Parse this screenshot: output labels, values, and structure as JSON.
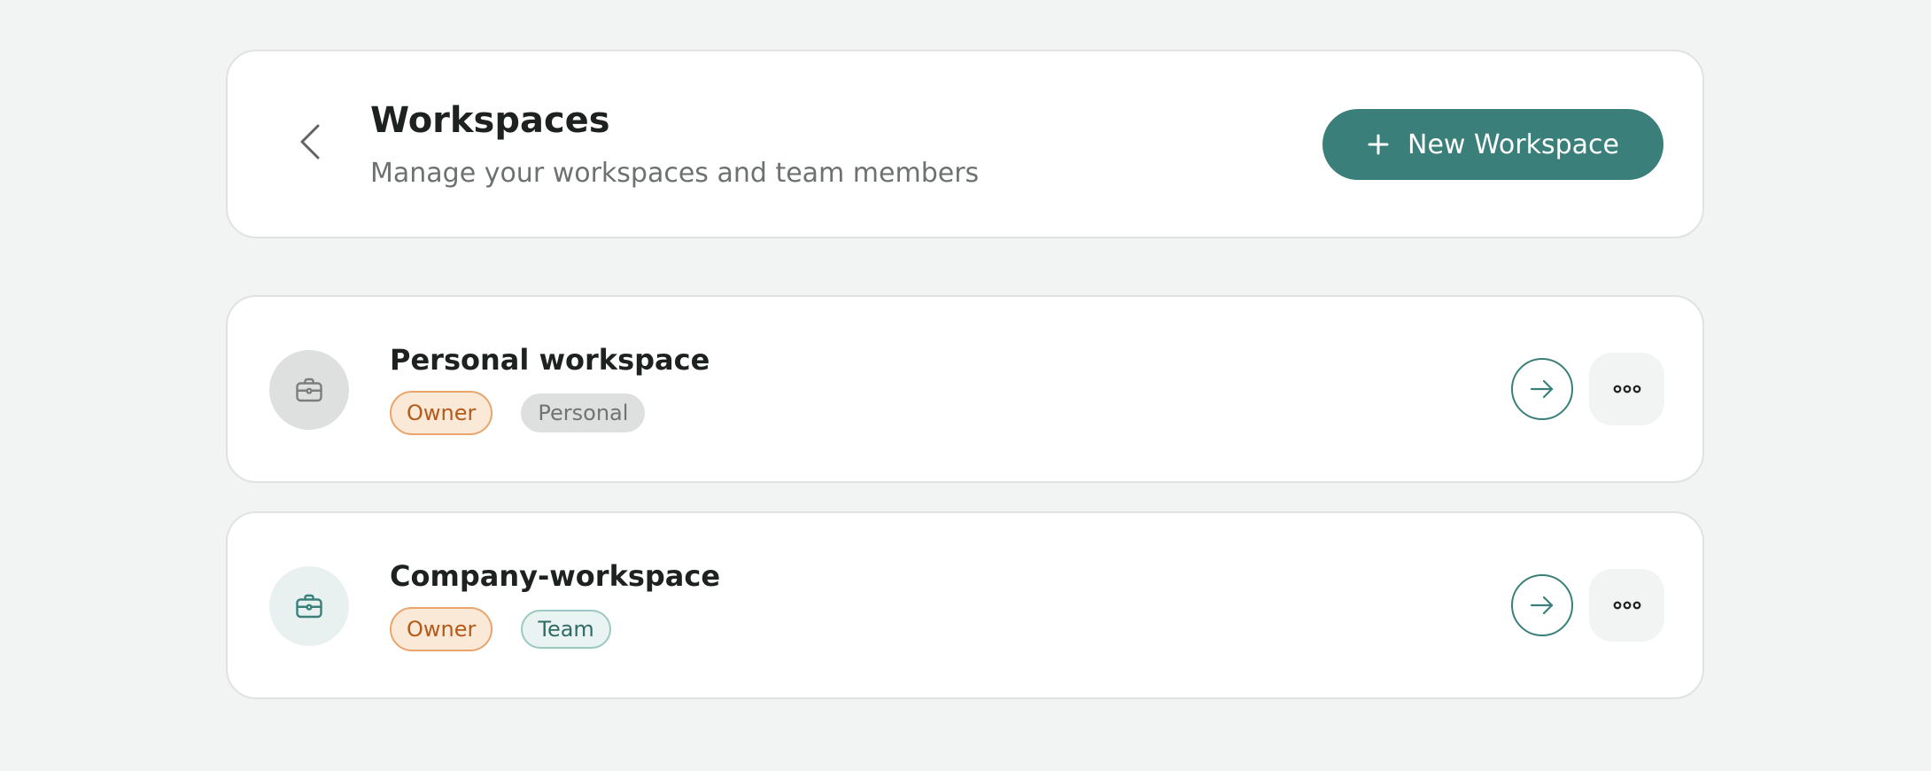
{
  "header": {
    "back_icon": "chevron-left-icon",
    "title": "Workspaces",
    "subtitle": "Manage your workspaces and team members",
    "new_button": {
      "icon": "plus-icon",
      "label": "New Workspace"
    }
  },
  "workspaces": [
    {
      "name": "Personal workspace",
      "icon": "briefcase-icon",
      "badges": [
        "Owner",
        "Personal"
      ],
      "open_icon": "arrow-right-icon",
      "more_icon": "more-horizontal-icon"
    },
    {
      "name": "Company-workspace",
      "icon": "briefcase-icon",
      "badges": [
        "Owner",
        "Team"
      ],
      "open_icon": "arrow-right-icon",
      "more_icon": "more-horizontal-icon"
    }
  ],
  "colors": {
    "accent": "#3a7f7a",
    "background": "#f2f4f3",
    "owner_badge_text": "#b45a1a",
    "owner_badge_bg": "#fbe9d8",
    "team_badge_text": "#2f6c66",
    "personal_badge_text": "#6f7473"
  }
}
